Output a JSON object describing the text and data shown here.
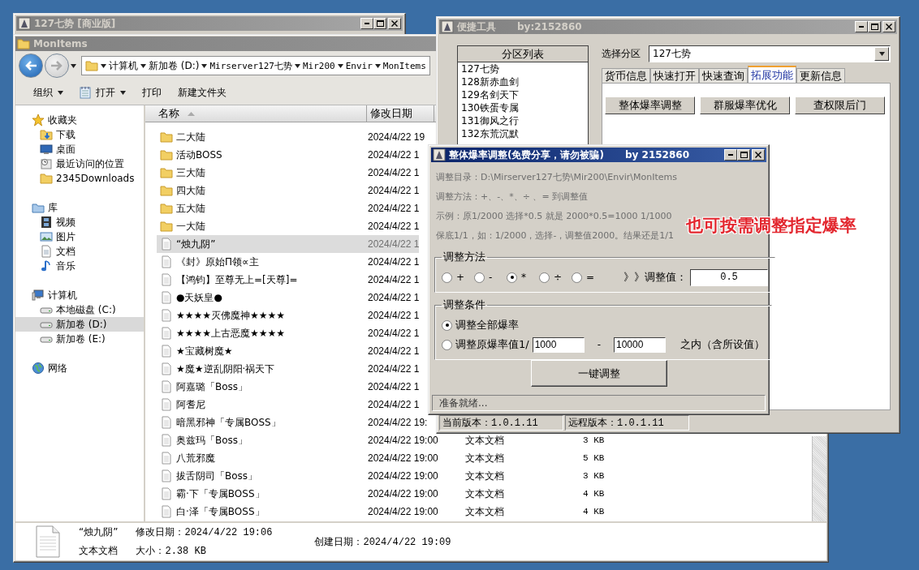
{
  "annotation": "也可按需调整指定爆率",
  "back_window": {
    "title": "127七势 [商业版]"
  },
  "explorer": {
    "title": "MonItems",
    "breadcrumb": [
      "计算机",
      "新加卷 (D:)",
      "Mirserver127七势",
      "Mir200",
      "Envir",
      "MonItems"
    ],
    "toolbar": [
      {
        "kind": "menu",
        "label": "组织",
        "dropdown": true
      },
      {
        "kind": "open",
        "label": "打开",
        "dropdown": true
      },
      {
        "kind": "plain",
        "label": "打印",
        "dropdown": false
      },
      {
        "kind": "plain",
        "label": "新建文件夹",
        "dropdown": false
      }
    ],
    "nav": [
      {
        "kind": "favorites",
        "label": "收藏夹",
        "selected": false,
        "children": [
          {
            "kind": "download",
            "label": "下载",
            "selected": false
          },
          {
            "kind": "desktop",
            "label": "桌面",
            "selected": false
          },
          {
            "kind": "recent",
            "label": "最近访问的位置",
            "selected": false
          },
          {
            "kind": "folder",
            "label": "2345Downloads",
            "selected": false
          }
        ]
      },
      {
        "kind": "library",
        "label": "库",
        "selected": false,
        "children": [
          {
            "kind": "video",
            "label": "视频",
            "selected": false
          },
          {
            "kind": "picture",
            "label": "图片",
            "selected": false
          },
          {
            "kind": "document",
            "label": "文档",
            "selected": false
          },
          {
            "kind": "music",
            "label": "音乐",
            "selected": false
          }
        ]
      },
      {
        "kind": "computer",
        "label": "计算机",
        "selected": false,
        "children": [
          {
            "kind": "drive",
            "label": "本地磁盘 (C:)",
            "selected": false
          },
          {
            "kind": "drive",
            "label": "新加卷 (D:)",
            "selected": true
          },
          {
            "kind": "drive",
            "label": "新加卷 (E:)",
            "selected": false
          }
        ]
      },
      {
        "kind": "network",
        "label": "网络",
        "selected": false
      }
    ],
    "columns": [
      {
        "label": "名称",
        "sorted": true
      },
      {
        "label": "修改日期",
        "sorted": false
      }
    ],
    "files": [
      {
        "kind": "folder",
        "name": "二大陆",
        "date": "2024/4/22 19",
        "selected": false
      },
      {
        "kind": "folder",
        "name": "活动BOSS",
        "date": "2024/4/22 1",
        "selected": false
      },
      {
        "kind": "folder",
        "name": "三大陆",
        "date": "2024/4/22 1",
        "selected": false
      },
      {
        "kind": "folder",
        "name": "四大陆",
        "date": "2024/4/22 1",
        "selected": false
      },
      {
        "kind": "folder",
        "name": "五大陆",
        "date": "2024/4/22 1",
        "selected": false
      },
      {
        "kind": "folder",
        "name": "一大陆",
        "date": "2024/4/22 1",
        "selected": false
      },
      {
        "kind": "file",
        "name": "“烛九阴”",
        "date": "2024/4/22 1",
        "selected": true
      },
      {
        "kind": "file",
        "name": "《封》原始Π领∝主",
        "date": "2024/4/22 1",
        "selected": false
      },
      {
        "kind": "file",
        "name": "【鸿钧】至尊无上=[天尊]=",
        "date": "2024/4/22 1",
        "selected": false
      },
      {
        "kind": "file",
        "name": "●天妖皇●",
        "date": "2024/4/22 1",
        "selected": false
      },
      {
        "kind": "file",
        "name": "★★★★灭佛魔神★★★★",
        "date": "2024/4/22 1",
        "selected": false
      },
      {
        "kind": "file",
        "name": "★★★★上古恶魔★★★★",
        "date": "2024/4/22 1",
        "selected": false
      },
      {
        "kind": "file",
        "name": "★宝藏树魔★",
        "date": "2024/4/22 1",
        "selected": false
      },
      {
        "kind": "file",
        "name": "★魔★逆乱阴阳·祸天下",
        "date": "2024/4/22 1",
        "selected": false
      },
      {
        "kind": "file",
        "name": "阿嘉璐「Boss」",
        "date": "2024/4/22 1",
        "selected": false
      },
      {
        "kind": "file",
        "name": "阿耆尼",
        "date": "2024/4/22 1",
        "selected": false
      },
      {
        "kind": "file",
        "name": "暗黑邪神「专属BOSS」",
        "date": "2024/4/22 19:",
        "selected": false
      },
      {
        "kind": "file",
        "name": "奥兹玛「Boss」",
        "date": "2024/4/22 19:00",
        "type": "文本文档",
        "size": "3 KB",
        "selected": false
      },
      {
        "kind": "file",
        "name": "八荒邪魔",
        "date": "2024/4/22 19:00",
        "type": "文本文档",
        "size": "5 KB",
        "selected": false
      },
      {
        "kind": "file",
        "name": "拔舌阴司「Boss」",
        "date": "2024/4/22 19:00",
        "type": "文本文档",
        "size": "3 KB",
        "selected": false
      },
      {
        "kind": "file",
        "name": "霸·下「专属BOSS」",
        "date": "2024/4/22 19:00",
        "type": "文本文档",
        "size": "4 KB",
        "selected": false
      },
      {
        "kind": "file",
        "name": "白·泽「专属BOSS」",
        "date": "2024/4/22 19:00",
        "type": "文本文档",
        "size": "4 KB",
        "selected": false
      }
    ],
    "details": {
      "name": "“烛九阴”",
      "type": "文本文档",
      "modified": "修改日期：2024/4/22 19:06",
      "created": "创建日期：2024/4/22 19:09",
      "size": "大小：2.38 KB"
    }
  },
  "tool": {
    "title": "便捷工具",
    "author": "by:2152860",
    "list_header": "分区列表",
    "partitions": [
      "127七势",
      "128新赤血剑",
      "129名剑天下",
      "130铁蛋专属",
      "131御风之行",
      "132东荒沉默"
    ],
    "select_label": "选择分区",
    "select_value": "127七势",
    "tabs": [
      {
        "label": "货币信息",
        "selected": false
      },
      {
        "label": "快速打开",
        "selected": false
      },
      {
        "label": "快速查询",
        "selected": false
      },
      {
        "label": "拓展功能",
        "selected": true
      },
      {
        "label": "更新信息",
        "selected": false
      }
    ],
    "actions": [
      "整体爆率调整",
      "群服爆率优化",
      "查权限后门"
    ],
    "status": [
      "当前版本：1.0.1.11",
      "远程版本：1.0.1.11"
    ]
  },
  "dialog": {
    "title": "整体爆率调整(免费分享，请勿被骗)",
    "author": "by 2152860",
    "info": [
      "调整目录：D:\\Mirserver127七势\\Mir200\\Envir\\MonItems",
      "调整方法：+、-、*、÷ 、=   到调整值",
      "示例：原1/2000 选择*0.5 就是 2000*0.5=1000  1/1000",
      "保底1/1，如：1/2000，选择-，调整值2000。结果还是1/1"
    ],
    "method_group": "调整方法",
    "methods": [
      {
        "label": "+",
        "selected": false
      },
      {
        "label": "-",
        "selected": false
      },
      {
        "label": "*",
        "selected": true
      },
      {
        "label": "÷",
        "selected": false
      },
      {
        "label": "=",
        "selected": false
      }
    ],
    "value_label": "》》调整值：",
    "value": "0.5",
    "condition_group": "调整条件",
    "conditions": [
      {
        "kind": "all",
        "label": "调整全部爆率",
        "selected": true
      },
      {
        "kind": "range",
        "label": "调整原爆率值1/",
        "from": "1000",
        "separator": "-",
        "to": "10000",
        "suffix": "之内（含所设值）",
        "selected": false
      }
    ],
    "run_button": "一键调整",
    "status": "准备就绪..."
  }
}
